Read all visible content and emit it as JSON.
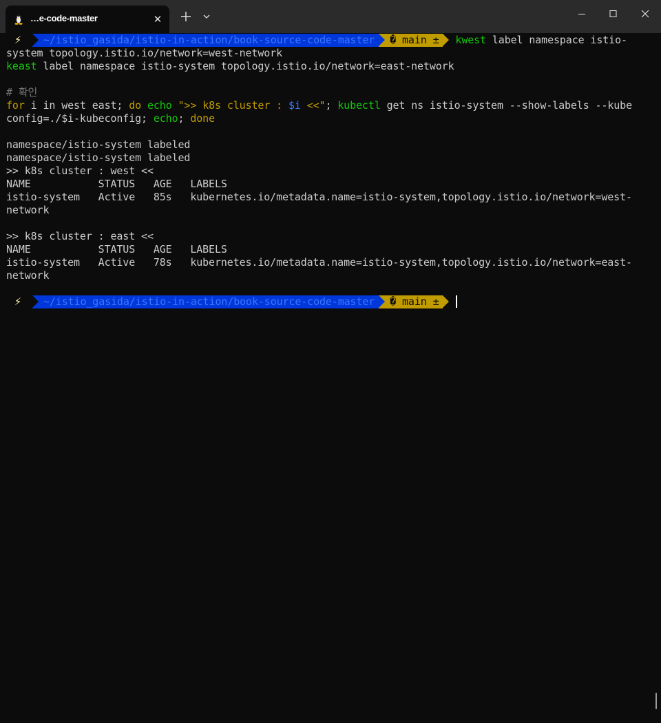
{
  "window": {
    "tab_title": "…e-code-master",
    "tab_icon": "linux-penguin-icon",
    "close_tab_glyph": "✕"
  },
  "prompt": {
    "bolt": "⚡",
    "path": "~/istio_gasida/istio-in-action/book-source-code-master",
    "branch": "� main ±"
  },
  "terminal": {
    "cmd1": {
      "name": "kwest",
      "args": " label namespace istio-"
    },
    "line2": "system topology.istio.io/network=west-network",
    "line3": {
      "name": "keast",
      "args": " label namespace istio-system topology.istio.io/network=east-network"
    },
    "blank1": "",
    "comment": "# 확인",
    "loop": {
      "kw_for": "for",
      "seg1": " i in west east; ",
      "kw_do": "do",
      "sp1": " ",
      "echo1": "echo",
      "sp2": " ",
      "str1": "\">> k8s cluster : ",
      "var": "$i",
      "str2": " <<\"",
      "semi": "; ",
      "kubectl": "kubectl",
      "rest": " get ns istio-system --show-labels --kube"
    },
    "loop2": {
      "seg1": "config=./$i-kubeconfig; ",
      "echo2": "echo",
      "semi": "; ",
      "kw_done": "done"
    },
    "blank2": "",
    "out": [
      "namespace/istio-system labeled",
      "namespace/istio-system labeled",
      ">> k8s cluster : west <<",
      "NAME           STATUS   AGE   LABELS",
      "istio-system   Active   85s   kubernetes.io/metadata.name=istio-system,topology.istio.io/network=west-",
      "network",
      "",
      ">> k8s cluster : east <<",
      "NAME           STATUS   AGE   LABELS",
      "istio-system   Active   78s   kubernetes.io/metadata.name=istio-system,topology.istio.io/network=east-",
      "network",
      ""
    ]
  }
}
